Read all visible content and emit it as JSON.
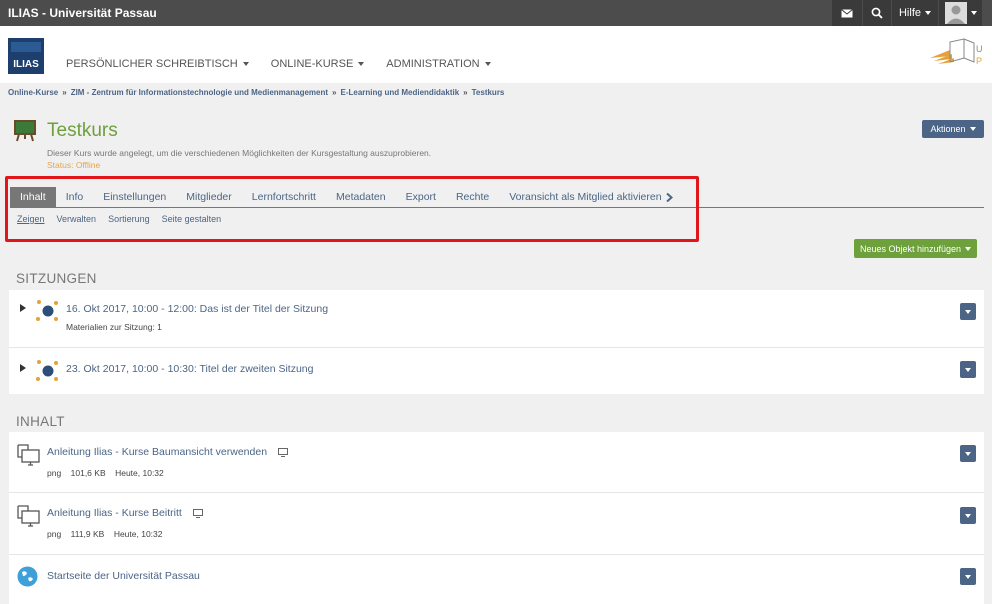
{
  "topbar": {
    "brand": "ILIAS - Universität Passau",
    "help_label": "Hilfe"
  },
  "header": {
    "logo_text": "ILIAS",
    "nav": [
      {
        "label": "PERSÖNLICHER SCHREIBTISCH"
      },
      {
        "label": "ONLINE-KURSE"
      },
      {
        "label": "ADMINISTRATION"
      }
    ]
  },
  "breadcrumb": [
    "Online-Kurse",
    "ZIM - Zentrum für Informationstechnologie und Medienmanagement",
    "E-Learning und Mediendidaktik",
    "Testkurs"
  ],
  "breadcrumb_sep": "»",
  "course": {
    "title": "Testkurs",
    "description": "Dieser Kurs wurde angelegt, um die verschiedenen Möglichkeiten der Kursgestaltung auszuprobieren.",
    "status": "Status: Offline",
    "actions_label": "Aktionen"
  },
  "tabs": [
    {
      "label": "Inhalt",
      "active": true
    },
    {
      "label": "Info"
    },
    {
      "label": "Einstellungen"
    },
    {
      "label": "Mitglieder"
    },
    {
      "label": "Lernfortschritt"
    },
    {
      "label": "Metadaten"
    },
    {
      "label": "Export"
    },
    {
      "label": "Rechte"
    },
    {
      "label": "Voransicht als Mitglied aktivieren"
    }
  ],
  "subtabs": [
    {
      "label": "Zeigen",
      "active": true
    },
    {
      "label": "Verwalten"
    },
    {
      "label": "Sortierung"
    },
    {
      "label": "Seite gestalten"
    }
  ],
  "new_object_label": "Neues Objekt hinzufügen",
  "sessions": {
    "heading": "SITZUNGEN",
    "items": [
      {
        "title": "16. Okt 2017, 10:00 - 12:00: Das ist der Titel der Sitzung",
        "meta": "Materialien zur Sitzung: 1"
      },
      {
        "title": "23. Okt 2017, 10:00 - 10:30: Titel der zweiten Sitzung"
      }
    ]
  },
  "content": {
    "heading": "INHALT",
    "items": [
      {
        "title": "Anleitung Ilias - Kurse Baumansicht verwenden",
        "type": "png",
        "size": "101,6 KB",
        "date": "Heute, 10:32"
      },
      {
        "title": "Anleitung Ilias - Kurse Beitritt",
        "type": "png",
        "size": "111,9 KB",
        "date": "Heute, 10:32"
      },
      {
        "title": "Startseite der Universität Passau"
      }
    ]
  },
  "colors": {
    "accent": "#4c6586",
    "green": "#6ea03c",
    "highlight": "#e0161b",
    "status": "#e8a34b"
  },
  "icons": [
    "mail-icon",
    "search-icon",
    "user-avatar-icon",
    "course-board-icon",
    "session-icon",
    "file-monitor-icon",
    "globe-icon"
  ]
}
